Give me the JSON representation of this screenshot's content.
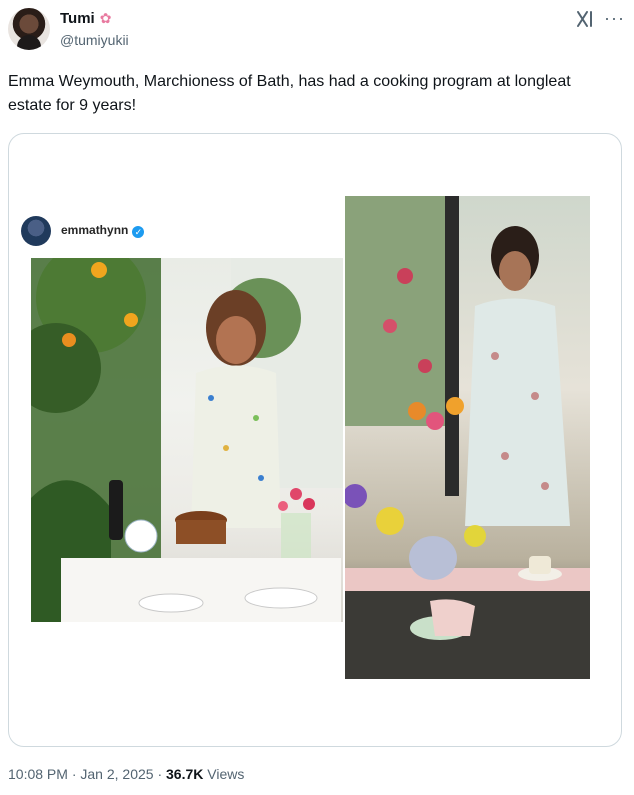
{
  "author": {
    "name": "Tumi",
    "handle": "@tumiyukii"
  },
  "tweet": {
    "text": "Emma Weymouth, Marchioness of Bath, has had a cooking program at longleat estate for 9 years!"
  },
  "embedded_post": {
    "username": "emmathynn",
    "verified_mark": "✓"
  },
  "footer": {
    "time": "10:08 PM",
    "date": "Jan 2, 2025",
    "separator": " · ",
    "views_count": "36.7K",
    "views_label": " Views"
  },
  "colors": {
    "text_primary": "#0f1419",
    "text_secondary": "#536471",
    "border": "#cfd9de",
    "accent": "#1d9bf0"
  },
  "icons": [
    "grok-icon",
    "more-icon",
    "verified-icon",
    "flower-icon"
  ]
}
